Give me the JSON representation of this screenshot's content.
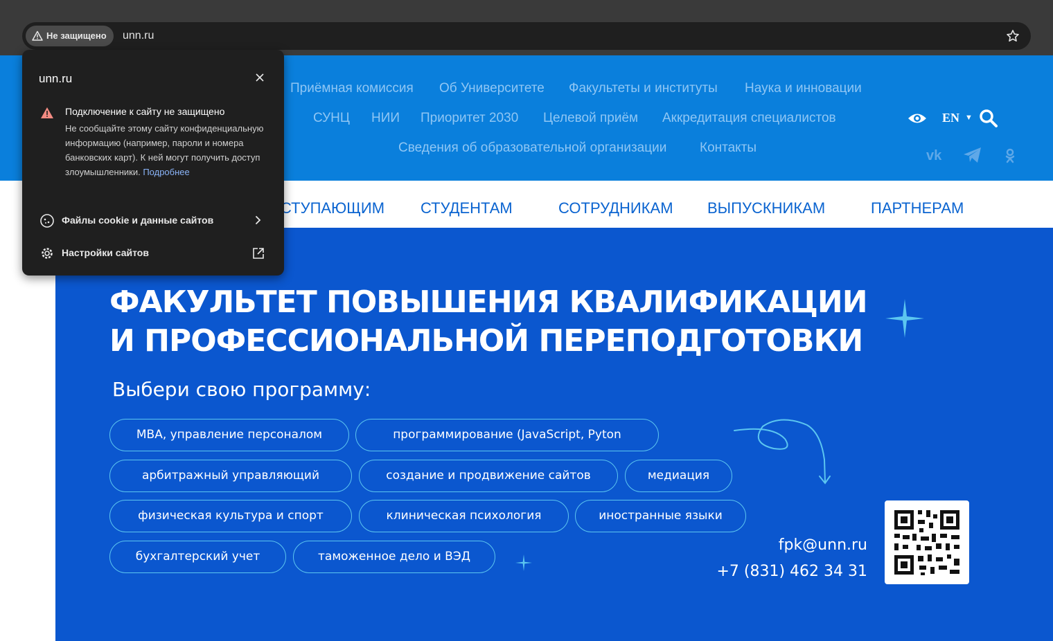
{
  "browser": {
    "security_chip": "Не защищено",
    "url": "unn.ru"
  },
  "popup": {
    "title": "unn.ru",
    "heading": "Подключение к сайту не защищено",
    "body": "Не сообщайте этому сайту конфиденциальную информацию (например, пароли и номера банковских карт). К ней могут получить доступ злоумышленники.",
    "link": "Подробнее",
    "cookies_label": "Файлы cookie и данные сайтов",
    "settings_label": "Настройки сайтов",
    "warning_color": "#f28b82"
  },
  "header": {
    "nav_row1": [
      "Приёмная комиссия",
      "Об Университете",
      "Факультеты и институты",
      "Наука и инновации"
    ],
    "nav_row2": [
      "СУНЦ",
      "НИИ",
      "Приоритет 2030",
      "Целевой приём",
      "Аккредитация специалистов"
    ],
    "nav_row3": [
      "Сведения об образовательной организации",
      "Контакты"
    ],
    "lang": "EN",
    "social": [
      "vk-icon",
      "telegram-icon",
      "odnoklassniki-icon"
    ]
  },
  "menu": {
    "items": [
      "ПОСТУПАЮЩИМ",
      "СТУДЕНТАМ",
      "СОТРУДНИКАМ",
      "ВЫПУСКНИКАМ",
      "ПАРТНЕРАМ"
    ],
    "visible_first_item_fragment": "СТУПАЮЩИМ"
  },
  "banner": {
    "headline_line1": "ФАКУЛЬТЕТ ПОВЫШЕНИЯ КВАЛИФИКАЦИИ",
    "headline_line2": "И ПРОФЕССИОНАЛЬНОЙ ПЕРЕПОДГОТОВКИ",
    "subtitle": "Выбери свою программу:",
    "programs": [
      "MBA, управление персоналом",
      "программирование (JavaScript, Pyton",
      "арбитражный управляющий",
      "создание и продвижение сайтов",
      "медиация",
      "физическая культура и спорт",
      "клиническая психология",
      "иностранные языки",
      "бухгалтерский учет",
      "таможенное дело и ВЭД"
    ],
    "email": "fpk@unn.ru",
    "phone": "+7 (831) 462 34 31",
    "background_color": "#0b57cf",
    "accent_color": "#5cc6f0"
  }
}
